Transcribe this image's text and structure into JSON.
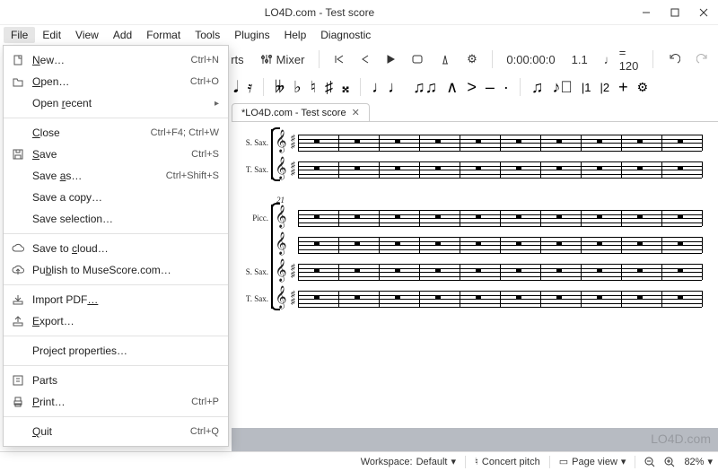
{
  "window": {
    "title": "LO4D.com - Test score"
  },
  "menubar": [
    "File",
    "Edit",
    "View",
    "Add",
    "Format",
    "Tools",
    "Plugins",
    "Help",
    "Diagnostic"
  ],
  "toolbar": {
    "parts": "Parts",
    "mixer": "Mixer",
    "time": "0:00:00:0",
    "position": "1.1",
    "tempo_note": "♩",
    "tempo_eq": "= 120"
  },
  "palette_glyphs": {
    "g1": [
      "𝅘𝅥",
      "𝄿"
    ],
    "g2": [
      "𝄫",
      "♭",
      "♮",
      "♯",
      "𝄪"
    ],
    "g3": [
      "♩♩",
      "♫♫",
      "∧",
      ">",
      "–",
      "·"
    ],
    "g4": [
      "♫",
      "♪𝅮",
      "|1",
      "|2",
      "+",
      "⚙"
    ]
  },
  "tab": {
    "label": "*LO4D.com - Test score"
  },
  "instruments": {
    "group1": [
      "S. Sax.",
      "T. Sax."
    ],
    "group2_mnum": "21",
    "group2": [
      "Picc.",
      "",
      "S. Sax.",
      "T. Sax."
    ]
  },
  "file_menu": [
    {
      "icon": "new",
      "label": "New…",
      "shortcut": "Ctrl+N",
      "u": 0
    },
    {
      "icon": "open",
      "label": "Open…",
      "shortcut": "Ctrl+O",
      "u": 0
    },
    {
      "icon": "",
      "label": "Open recent",
      "shortcut": "",
      "submenu": true,
      "u": 5
    },
    {
      "sep": true
    },
    {
      "icon": "",
      "label": "Close",
      "shortcut": "Ctrl+F4; Ctrl+W",
      "u": 0
    },
    {
      "icon": "save",
      "label": "Save",
      "shortcut": "Ctrl+S",
      "u": 0
    },
    {
      "icon": "",
      "label": "Save as…",
      "shortcut": "Ctrl+Shift+S",
      "u": 5
    },
    {
      "icon": "",
      "label": "Save a copy…",
      "shortcut": ""
    },
    {
      "icon": "",
      "label": "Save selection…",
      "shortcut": ""
    },
    {
      "sep": true
    },
    {
      "icon": "cloud",
      "label": "Save to cloud…",
      "shortcut": "",
      "u": 8
    },
    {
      "icon": "publish",
      "label": "Publish to MuseScore.com…",
      "shortcut": "",
      "u": 2
    },
    {
      "sep": true
    },
    {
      "icon": "import",
      "label": "Import PDF…",
      "shortcut": "",
      "u": 10
    },
    {
      "icon": "export",
      "label": "Export…",
      "shortcut": "",
      "u": 0
    },
    {
      "sep": true
    },
    {
      "icon": "",
      "label": "Project properties…",
      "shortcut": ""
    },
    {
      "sep": true
    },
    {
      "icon": "parts",
      "label": "Parts",
      "shortcut": ""
    },
    {
      "icon": "print",
      "label": "Print…",
      "shortcut": "Ctrl+P",
      "u": 0
    },
    {
      "sep": true
    },
    {
      "icon": "",
      "label": "Quit",
      "shortcut": "Ctrl+Q",
      "u": 0
    }
  ],
  "statusbar": {
    "workspace_label": "Workspace:",
    "workspace_value": "Default",
    "concert": "Concert pitch",
    "pageview": "Page view",
    "zoom": "82%"
  },
  "watermark": "LO4D.com"
}
